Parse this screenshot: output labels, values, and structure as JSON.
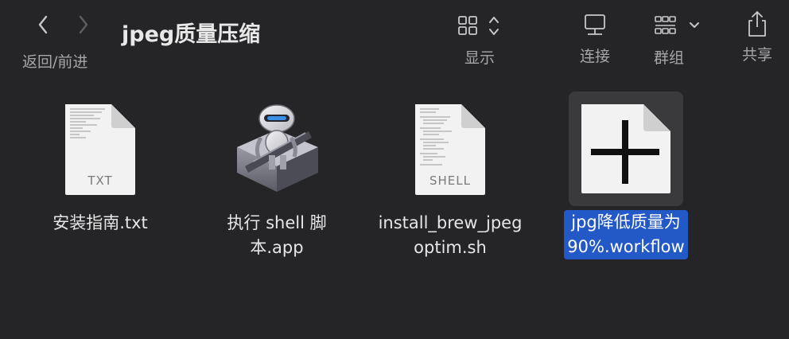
{
  "window": {
    "title": "jpeg质量压缩"
  },
  "toolbar": {
    "back_forward_label": "返回/前进",
    "display_label": "显示",
    "connect_label": "连接",
    "group_label": "群组",
    "share_label": "共享"
  },
  "files": [
    {
      "name_line1": "安装指南.txt",
      "name_line2": "",
      "badge": "TXT"
    },
    {
      "name_line1": "执行 shell 脚",
      "name_line2": "本.app",
      "badge": ""
    },
    {
      "name_line1": "install_brew_jpeg",
      "name_line2": "optim.sh",
      "badge": "SHELL"
    },
    {
      "name_line1": "jpg降低质量为",
      "name_line2": "90%.workflow",
      "badge": ""
    }
  ],
  "colors": {
    "background": "#252528",
    "selection": "#2358c7"
  }
}
